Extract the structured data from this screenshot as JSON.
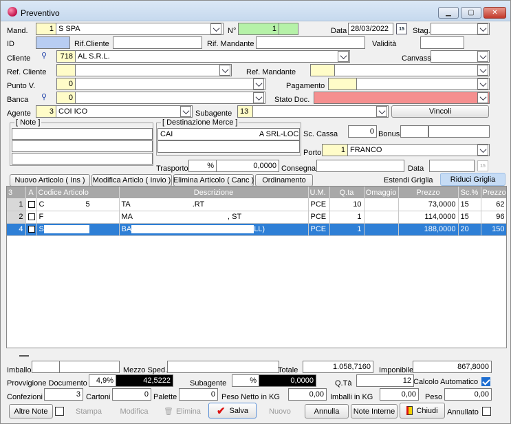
{
  "window": {
    "title": "Preventivo"
  },
  "header": {
    "mand_label": "Mand.",
    "mand_code": "1",
    "mand_name": "S                 SPA",
    "n_label": "N°",
    "n_value": "1",
    "data_label": "Data",
    "data_value": "28/03/2022",
    "stag_label": "Stag.",
    "id_label": "ID",
    "rif_cliente_label": "Rif.Cliente",
    "rif_mandante_label": "Rif. Mandante",
    "validita_label": "Validità",
    "cliente_label": "Cliente",
    "cliente_code": "718",
    "cliente_name": "AL                              S.R.L.",
    "canvass_label": "Canvass",
    "ref_cliente_label": "Ref. Cliente",
    "ref_mandante_label": "Ref. Mandante",
    "punto_v_label": "Punto V.",
    "punto_v_code": "0",
    "pagamento_label": "Pagamento",
    "banca_label": "Banca",
    "banca_code": "0",
    "stato_doc_label": "Stato Doc.",
    "agente_label": "Agente",
    "agente_code": "3",
    "agente_name": "COI                               ICO",
    "subagente_label": "Subagente",
    "subagente_code": "13",
    "vincoli_label": "Vincoli"
  },
  "note_box": {
    "title": "[ Note ]"
  },
  "dest_box": {
    "title": "[ Destinazione Merce ]",
    "line1_left": "CAI",
    "line1_right": "A SRL-LOC"
  },
  "side": {
    "sc_cassa_label": "Sc. Cassa",
    "sc_cassa_value": "0",
    "bonus_label": "Bonus",
    "porto_label": "Porto",
    "porto_code": "1",
    "porto_name": "FRANCO",
    "trasporto_label": "Trasporto",
    "trasporto_unit": "%",
    "trasporto_value": "0,0000",
    "consegna_label": "Consegna",
    "data2_label": "Data"
  },
  "actions": {
    "nuovo": "Nuovo Articolo ( Ins )",
    "modifica": "Modifica Articlo ( Invio )",
    "elimina": "Elimina Articolo ( Canc )",
    "ordinamento": "Ordinamento",
    "estendi": "Estendi Griglia",
    "riduci": "Riduci Griglia"
  },
  "grid": {
    "columns": [
      "3",
      "A",
      "Codice Articolo",
      "Descrizione",
      "U.M.",
      "Q.ta",
      "Omaggio",
      "Prezzo",
      "Sc.%",
      "Prezzo"
    ],
    "rows": [
      {
        "n": "1",
        "code": "C",
        "code2": "5",
        "desc": "TA",
        "desc2": ".RT",
        "um": "PCE",
        "qta": "10",
        "prezzo": "73,0000",
        "sc": "15",
        "prezzo2": "62"
      },
      {
        "n": "2",
        "code": "F",
        "code2": "",
        "desc": "MA",
        "desc2": ", ST",
        "um": "PCE",
        "qta": "1",
        "prezzo": "114,0000",
        "sc": "15",
        "prezzo2": "96"
      },
      {
        "n": "4",
        "code": "S",
        "code2": "",
        "desc": "BA",
        "desc2": "LL)",
        "um": "PCE",
        "qta": "1",
        "prezzo": "188,0000",
        "sc": "20",
        "prezzo2": "150"
      }
    ]
  },
  "footer": {
    "imballo_label": "Imballo",
    "mezzo_label": "Mezzo Sped.",
    "totale_label": "Totale",
    "totale_value": "1.058,7160",
    "imponibile_label": "Imponibile",
    "imponibile_value": "867,8000",
    "provv_label": "Provvigione Documento",
    "provv_pct": "4,9%",
    "provv_value": "42,5222",
    "subagente_label": "Subagente",
    "sub_unit": "%",
    "sub_value": "0,0000",
    "qta_label": "Q.Tà",
    "qta_value": "12",
    "calcolo_label": "Calcolo Automatico",
    "confezioni_label": "Confezioni",
    "confezioni_value": "3",
    "cartoni_label": "Cartoni",
    "cartoni_value": "0",
    "palette_label": "Palette",
    "palette_value": "0",
    "peso_netto_label": "Peso Netto in KG",
    "peso_netto_value": "0,00",
    "imballi_label": "Imballi in KG",
    "imballi_value": "0,00",
    "peso_label": "Peso",
    "peso_value": "0,00"
  },
  "bottom": {
    "altre_note": "Altre Note",
    "stampa": "Stampa",
    "modifica": "Modifica",
    "elimina": "Elimina",
    "salva": "Salva",
    "nuovo": "Nuovo",
    "annulla": "Annulla",
    "note_interne": "Note Interne",
    "chiudi": "Chiudi",
    "annullato": "Annullato"
  }
}
